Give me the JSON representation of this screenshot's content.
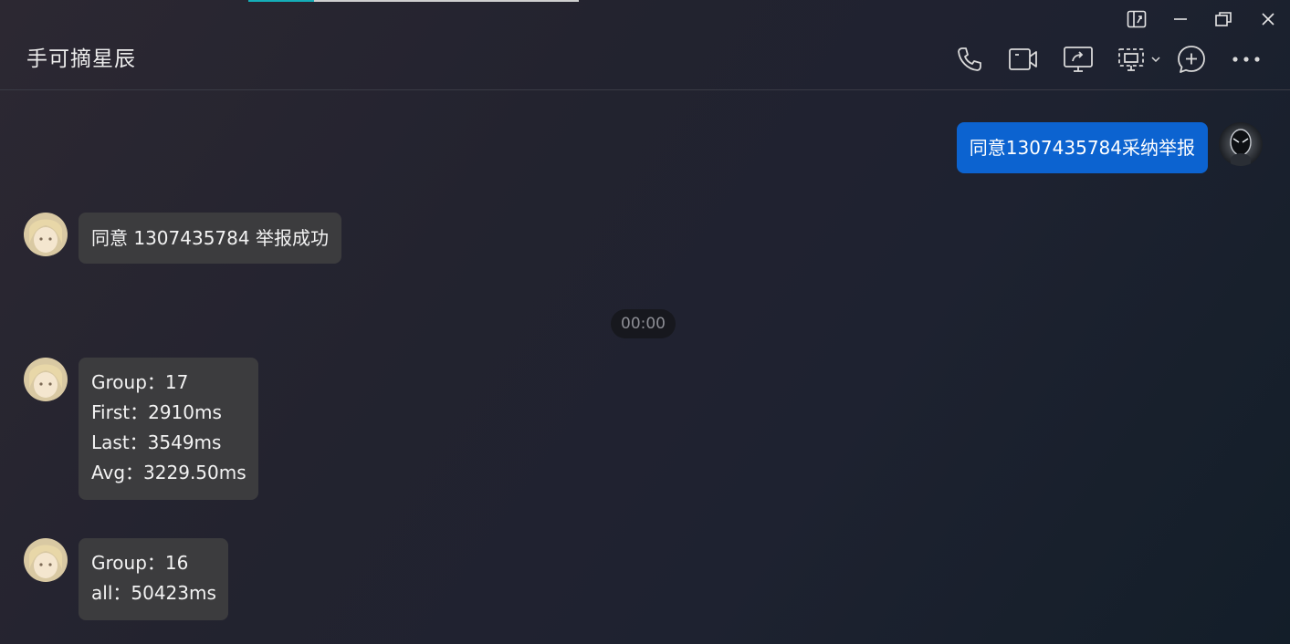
{
  "window": {
    "loading_progress": 0.2
  },
  "header": {
    "title": "手可摘星辰",
    "icons": [
      "phone-icon",
      "video-call-icon",
      "screen-share-icon",
      "remote-desktop-icon",
      "add-member-icon",
      "more-icon"
    ]
  },
  "window_controls": [
    "pin-window-icon",
    "minimize-icon",
    "restore-icon",
    "close-icon"
  ],
  "messages": [
    {
      "side": "right",
      "text": "同意1307435784采纳举报"
    },
    {
      "side": "left",
      "text": "同意 1307435784 举报成功"
    },
    {
      "type": "timestamp",
      "text": "00:00"
    },
    {
      "side": "left",
      "lines": [
        "Group：17",
        "First：2910ms",
        "Last：3549ms",
        "Avg：3229.50ms"
      ]
    },
    {
      "side": "left",
      "lines": [
        "Group：16",
        "all：50423ms"
      ]
    }
  ],
  "colors": {
    "outgoing_bubble": "#0c63d0",
    "incoming_bubble": "#3c3c3e",
    "loading_accent": "#15aeb8",
    "timestamp_bg": "#17181e"
  }
}
